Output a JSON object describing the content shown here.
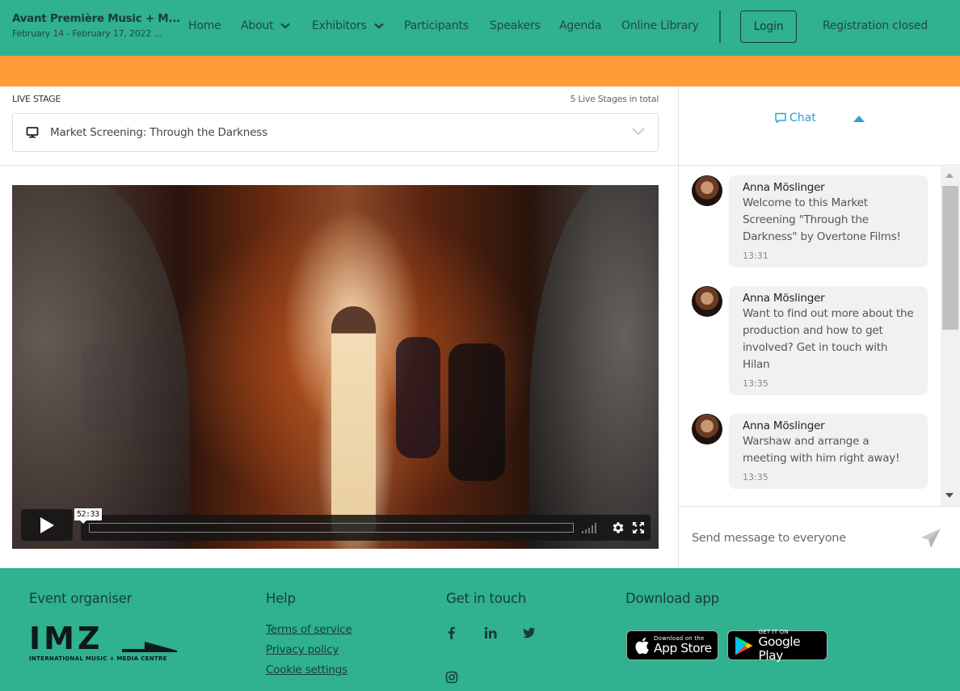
{
  "header": {
    "event_title": "Avant Première Music + M...",
    "event_dates": "February 14 - February 17, 2022 ...",
    "nav": [
      {
        "label": "Home",
        "has_dropdown": false
      },
      {
        "label": "About",
        "has_dropdown": true
      },
      {
        "label": "Exhibitors",
        "has_dropdown": true
      },
      {
        "label": "Participants",
        "has_dropdown": false
      },
      {
        "label": "Speakers",
        "has_dropdown": false
      },
      {
        "label": "Agenda",
        "has_dropdown": false
      },
      {
        "label": "Online Library",
        "has_dropdown": false
      }
    ],
    "login_label": "Login",
    "registration_status": "Registration closed"
  },
  "colors": {
    "header_bg": "#30b18f",
    "banner_bg": "#ff9c37",
    "accent_blue": "#2a9fd6",
    "text_dark": "#183c3a"
  },
  "stage": {
    "section_label": "LIVE STAGE",
    "total_label": "5 Live Stages in total",
    "selected_stage": "Market Screening: Through the Darkness",
    "stage_icon": "monitor-icon"
  },
  "player": {
    "hover_time": "52:33",
    "state": "paused",
    "progress_fraction": 0,
    "icons": [
      "play-icon",
      "volume-icon",
      "gear-icon",
      "fullscreen-icon"
    ]
  },
  "chat": {
    "tab_label": "Chat",
    "input_placeholder": "Send message to everyone",
    "messages": [
      {
        "author": "Anna Möslinger",
        "text": "Welcome to this Market Screening \"Through the Darkness\" by Overtone Films!",
        "time": "13:31"
      },
      {
        "author": "Anna Möslinger",
        "text": "Want to find out more about the production and how to get involved? Get in touch with Hilan",
        "time": "13:35"
      },
      {
        "author": "Anna Möslinger",
        "text": "Warshaw and arrange a meeting with him right away!",
        "time": "13:35"
      }
    ]
  },
  "footer": {
    "organiser_heading": "Event organiser",
    "organiser_logo_text": "IMZ",
    "organiser_logo_subtext": "INTERNATIONAL MUSIC + MEDIA CENTRE",
    "help_heading": "Help",
    "help_links": [
      "Terms of service",
      "Privacy policy",
      "Cookie settings"
    ],
    "contact_heading": "Get in touch",
    "social_icons": [
      "facebook-icon",
      "linkedin-icon",
      "twitter-icon",
      "instagram-icon"
    ],
    "download_heading": "Download app",
    "app_store": {
      "small": "Download on the",
      "big": "App Store"
    },
    "google_play": {
      "small": "GET IT ON",
      "big": "Google Play"
    }
  }
}
